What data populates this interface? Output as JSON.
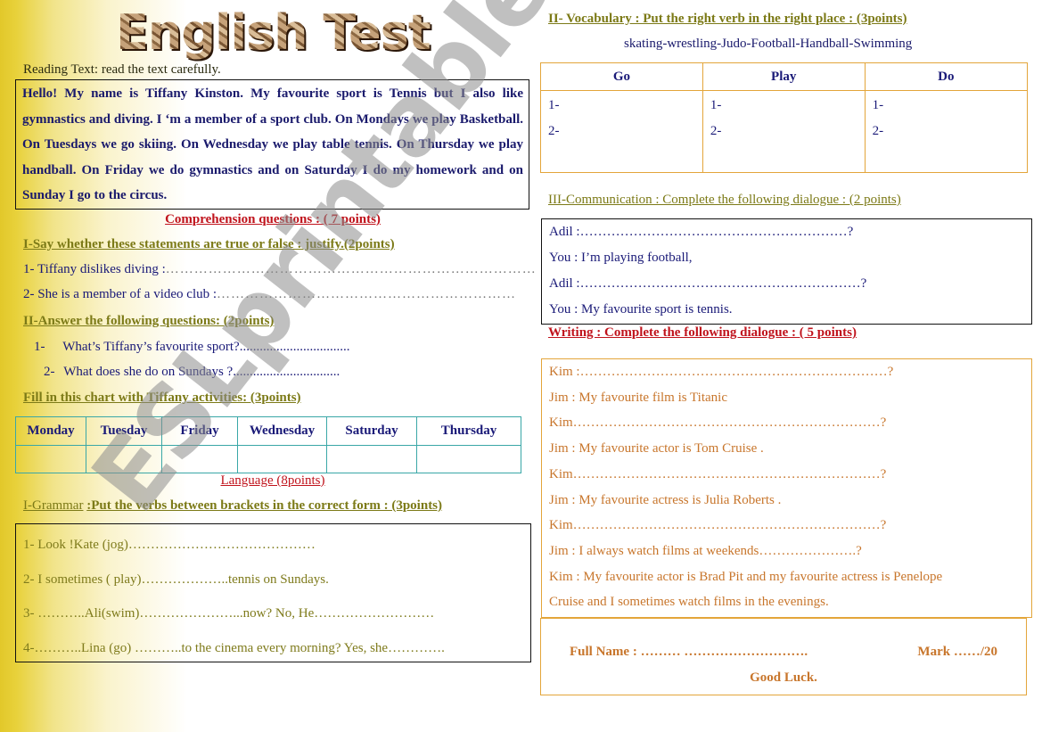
{
  "title": "English Test",
  "reading": {
    "label": "Reading Text: read the text carefully.",
    "text": "Hello! My name is Tiffany Kinston. My favourite sport is Tennis but I also like gymnastics and diving. I ‘m a member of a  sport club. On Mondays we play Basketball. On Tuesdays we go skiing. On Wednesday we play table tennis. On Thursday we play handball. On Friday we do gymnastics and on Saturday I do my homework and on Sunday I go to the circus."
  },
  "comprehension": {
    "heading": "Comprehension questions : ( 7 points)",
    "true_false": {
      "heading": "I-Say whether these statements are true or false : justify.(2points)",
      "items": [
        "1- Tiffany dislikes diving :",
        "2- She is a member of a video club :"
      ],
      "dots": [
        "……………………………………………………………………",
        "………………………………………………………"
      ]
    },
    "answer": {
      "heading": "II-Answer the following questions: (2points)",
      "items": [
        {
          "num": "1-",
          "text": "What’s Tiffany’s favourite sport?................................."
        },
        {
          "num": "2-",
          "text": "What does she do on Sundays ?................................"
        }
      ]
    },
    "chart": {
      "heading": "Fill in this chart with Tiffany activities: (3points)",
      "days": [
        "Monday",
        "Tuesday",
        "Friday",
        "Wednesday",
        "Saturday",
        "Thursday"
      ]
    }
  },
  "language": {
    "heading": "Language (8points)",
    "grammar": {
      "label": "I-Grammar",
      "heading": ":Put the verbs between brackets in the correct form : (3points)",
      "items": [
        "1- Look !Kate (jog)……………………………………",
        "2- I sometimes ( play)………………..tennis on Sundays.",
        "3- ………..Ali(swim)…………………...now? No, He………………………",
        "4-………..Lina (go)  ………..to the cinema every morning? Yes, she…………."
      ]
    },
    "vocabulary": {
      "heading": "II-  Vocabulary : Put the right verb in the right place : (3points)",
      "words": "skating-wrestling-Judo-Football-Handball-Swimming",
      "columns": [
        "Go",
        "Play",
        "Do"
      ],
      "rows": [
        "1-",
        "2-"
      ]
    },
    "communication": {
      "heading": "III-Communication : Complete the following dialogue : (2 points)",
      "lines": [
        "Adil :……………………………………………………?",
        "You : I’m playing football,",
        "Adil :………………………………………………………?",
        "You : My favourite sport is tennis."
      ]
    }
  },
  "writing": {
    "heading": "Writing : Complete the following dialogue : ( 5 points)",
    "lines": [
      "Kim :……………………………………………………………?",
      "Jim : My favourite film is Titanic",
      "Kim……………………………………………………………?",
      "Jim : My favourite actor is Tom Cruise .",
      "Kim……………………………………………………………?",
      "Jim : My favourite actress is Julia Roberts  .",
      "Kim……………………………………………………………?",
      "Jim : I always watch films at weekends………………….?",
      "Kim : My favourite actor is Brad Pit and my favourite actress is Penelope",
      "Cruise   and I sometimes  watch films in the evenings."
    ]
  },
  "footer": {
    "full_name": "Full Name :  ……… ……………………….",
    "mark": "Mark ……/20",
    "good_luck": "Good Luck."
  },
  "watermark": "ESLprintables.com",
  "colors": {
    "heading_olive": "#7c7a17",
    "heading_red": "#c0131c",
    "text_navy": "#1a1a78",
    "text_orange": "#c8762c",
    "border_teal": "#3aa7a7",
    "border_orange": "#e3a53a",
    "side_yellow": "#e2c82a"
  }
}
